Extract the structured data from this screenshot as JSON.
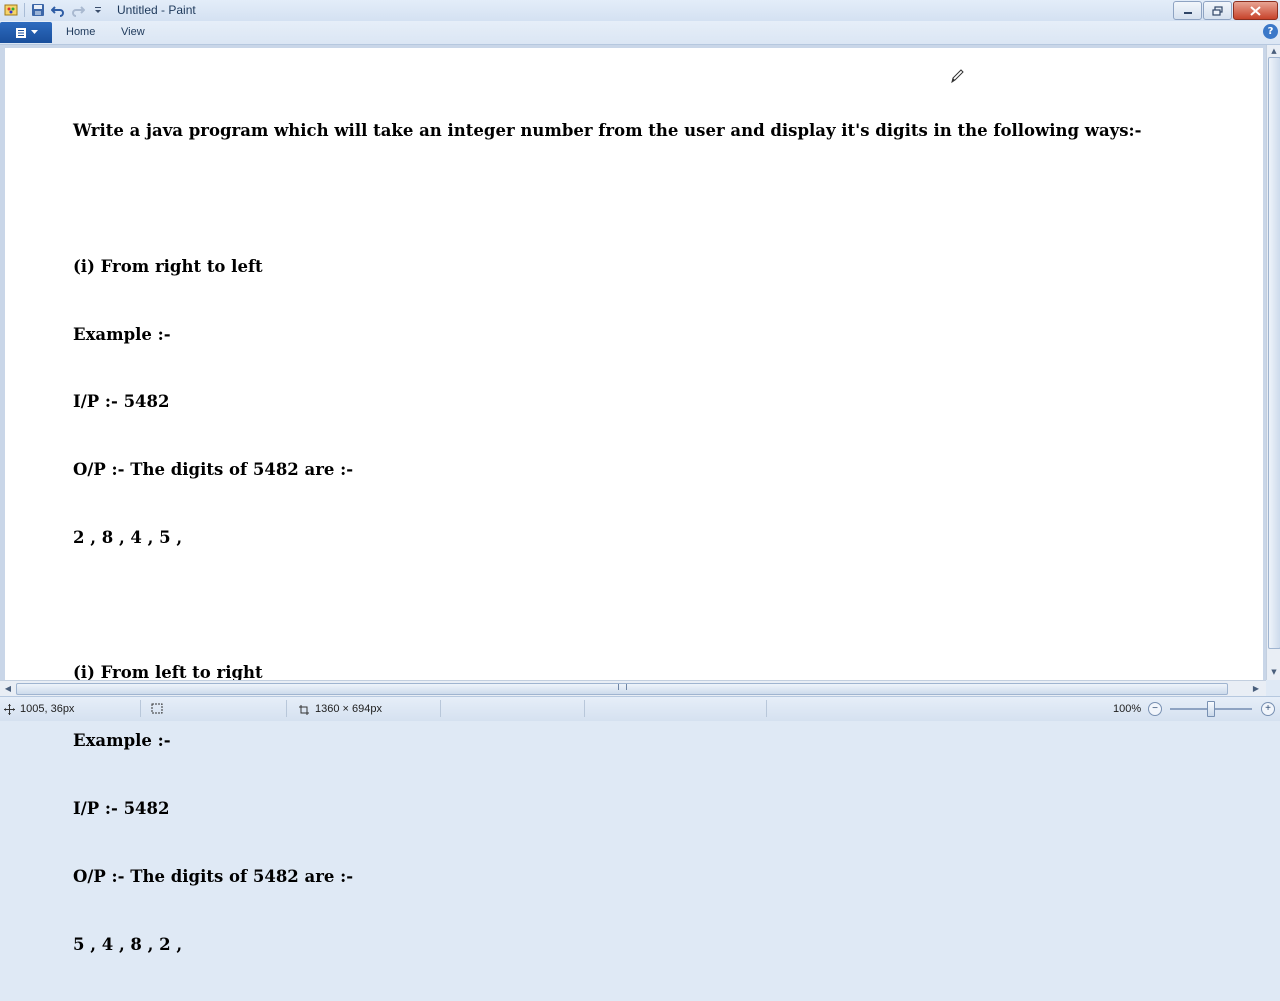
{
  "window": {
    "title": "Untitled - Paint"
  },
  "ribbon": {
    "tabs": [
      {
        "label": "Home"
      },
      {
        "label": "View"
      }
    ],
    "help_label": "?"
  },
  "document": {
    "lines": [
      "Write a java program which will take an integer number from the user and display it's digits in the following ways:-",
      "",
      "(i) From right to left",
      "Example :-",
      "I/P :- 5482",
      "O/P :- The digits of 5482 are :-",
      "2 , 8 , 4 , 5 ,",
      "",
      "(i) From left to right",
      "Example :-",
      "I/P :- 5482",
      "O/P :- The digits of 5482 are :-",
      "5 , 4 , 8 , 2 ,"
    ]
  },
  "status": {
    "cursor_position": "1005, 36px",
    "image_size": "1360 × 694px",
    "zoom": "100%"
  },
  "colors": {
    "accent": "#1a4f9c",
    "canvas": "#ffffff",
    "chrome": "#dfe9f5"
  }
}
